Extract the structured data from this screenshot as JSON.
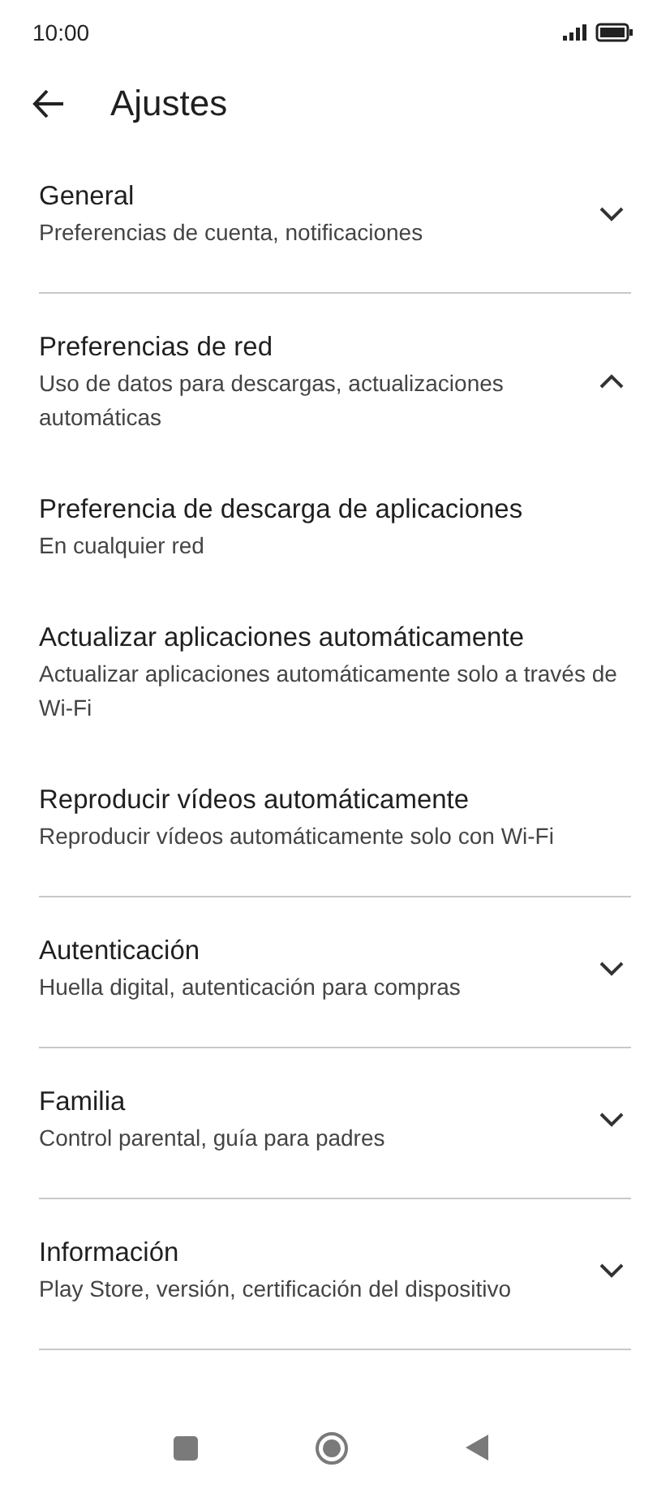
{
  "status_bar": {
    "time": "10:00"
  },
  "header": {
    "title": "Ajustes"
  },
  "sections": [
    {
      "title": "General",
      "subtitle": "Preferencias de cuenta, notificaciones",
      "expanded": false
    },
    {
      "title": "Preferencias de red",
      "subtitle": "Uso de datos para descargas, actualizaciones automáticas",
      "expanded": true,
      "children": [
        {
          "title": "Preferencia de descarga de aplicaciones",
          "subtitle": "En cualquier red"
        },
        {
          "title": "Actualizar aplicaciones automáticamente",
          "subtitle": "Actualizar aplicaciones automáticamente solo a través de Wi-Fi"
        },
        {
          "title": "Reproducir vídeos automáticamente",
          "subtitle": "Reproducir vídeos automáticamente solo con Wi-Fi"
        }
      ]
    },
    {
      "title": "Autenticación",
      "subtitle": "Huella digital, autenticación para compras",
      "expanded": false
    },
    {
      "title": "Familia",
      "subtitle": "Control parental, guía para padres",
      "expanded": false
    },
    {
      "title": "Información",
      "subtitle": "Play Store, versión, certificación del dispositivo",
      "expanded": false
    }
  ]
}
